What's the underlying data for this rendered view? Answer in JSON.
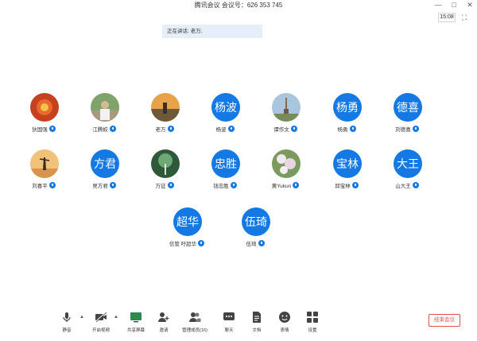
{
  "window": {
    "title": "腾讯会议 会议号：626 353 745",
    "controls": {
      "min": "—",
      "max": "□",
      "close": "✕"
    }
  },
  "clock": "15:08",
  "speaking": {
    "label": "正在讲话: 老万;"
  },
  "participants": [
    {
      "name": "狄国强",
      "kind": "photo",
      "avatar_text": "",
      "photo_theme": "red-flower"
    },
    {
      "name": "江腾蛟",
      "kind": "photo",
      "avatar_text": "",
      "photo_theme": "man-outdoors"
    },
    {
      "name": "老万",
      "kind": "photo",
      "avatar_text": "",
      "photo_theme": "sunset-person"
    },
    {
      "name": "杨波",
      "kind": "text",
      "avatar_text": "杨波"
    },
    {
      "name": "谭作文",
      "kind": "photo",
      "avatar_text": "",
      "photo_theme": "tower"
    },
    {
      "name": "杨勇",
      "kind": "text",
      "avatar_text": "杨勇"
    },
    {
      "name": "刘德喜",
      "kind": "text",
      "avatar_text": "德喜"
    },
    {
      "name": "刘喜平",
      "kind": "photo",
      "avatar_text": "",
      "photo_theme": "silhouette-sunset"
    },
    {
      "name": "吴方君",
      "kind": "text",
      "avatar_text": "方君"
    },
    {
      "name": "万征",
      "kind": "photo",
      "avatar_text": "",
      "photo_theme": "green-tree"
    },
    {
      "name": "钱忠胜",
      "kind": "text",
      "avatar_text": "忠胜"
    },
    {
      "name": "黄Yukun",
      "kind": "photo",
      "avatar_text": "",
      "photo_theme": "flowers"
    },
    {
      "name": "邱宝林",
      "kind": "text",
      "avatar_text": "宝林"
    },
    {
      "name": "山大王",
      "kind": "text",
      "avatar_text": "大王"
    },
    {
      "name": "信管 吁超华",
      "kind": "text",
      "avatar_text": "超华"
    },
    {
      "name": "伍琦",
      "kind": "text",
      "avatar_text": "伍琦"
    }
  ],
  "toolbar": {
    "mute": "静音",
    "video": "开启视频",
    "share": "共享屏幕",
    "invite": "邀请",
    "members": "管理成员(16)",
    "chat": "聊天",
    "docs": "文档",
    "emoji": "表情",
    "settings": "设置",
    "end": "结束会议"
  },
  "colors": {
    "accent": "#1579e5",
    "end": "#e34d4d",
    "banner": "#e5eef9"
  }
}
